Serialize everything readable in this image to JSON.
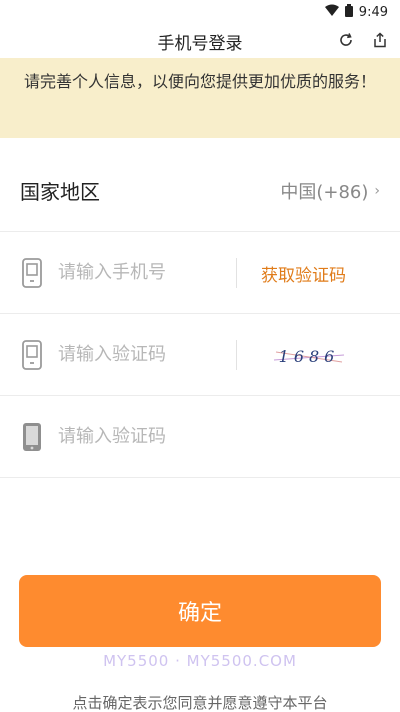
{
  "status_bar": {
    "time": "9:49"
  },
  "nav": {
    "title": "手机号登录"
  },
  "notice": {
    "text": "请完善个人信息，以便向您提供更加优质的服务！"
  },
  "form": {
    "country": {
      "label": "国家地区",
      "value": "中国(+86)"
    },
    "phone": {
      "placeholder": "请输入手机号",
      "get_code_label": "获取验证码"
    },
    "image_code": {
      "placeholder": "请输入验证码",
      "captcha_text": "1686"
    },
    "sms_code": {
      "placeholder": "请输入验证码"
    }
  },
  "confirm_button": {
    "label": "确定"
  },
  "watermark": {
    "text": "MY5500 · MY5500.COM"
  },
  "agreement": {
    "text": "点击确定表示您同意并愿意遵守本平台"
  },
  "colors": {
    "accent": "#fe8b2f",
    "notice_bg": "#f8eecb",
    "link": "#e07c1a"
  }
}
